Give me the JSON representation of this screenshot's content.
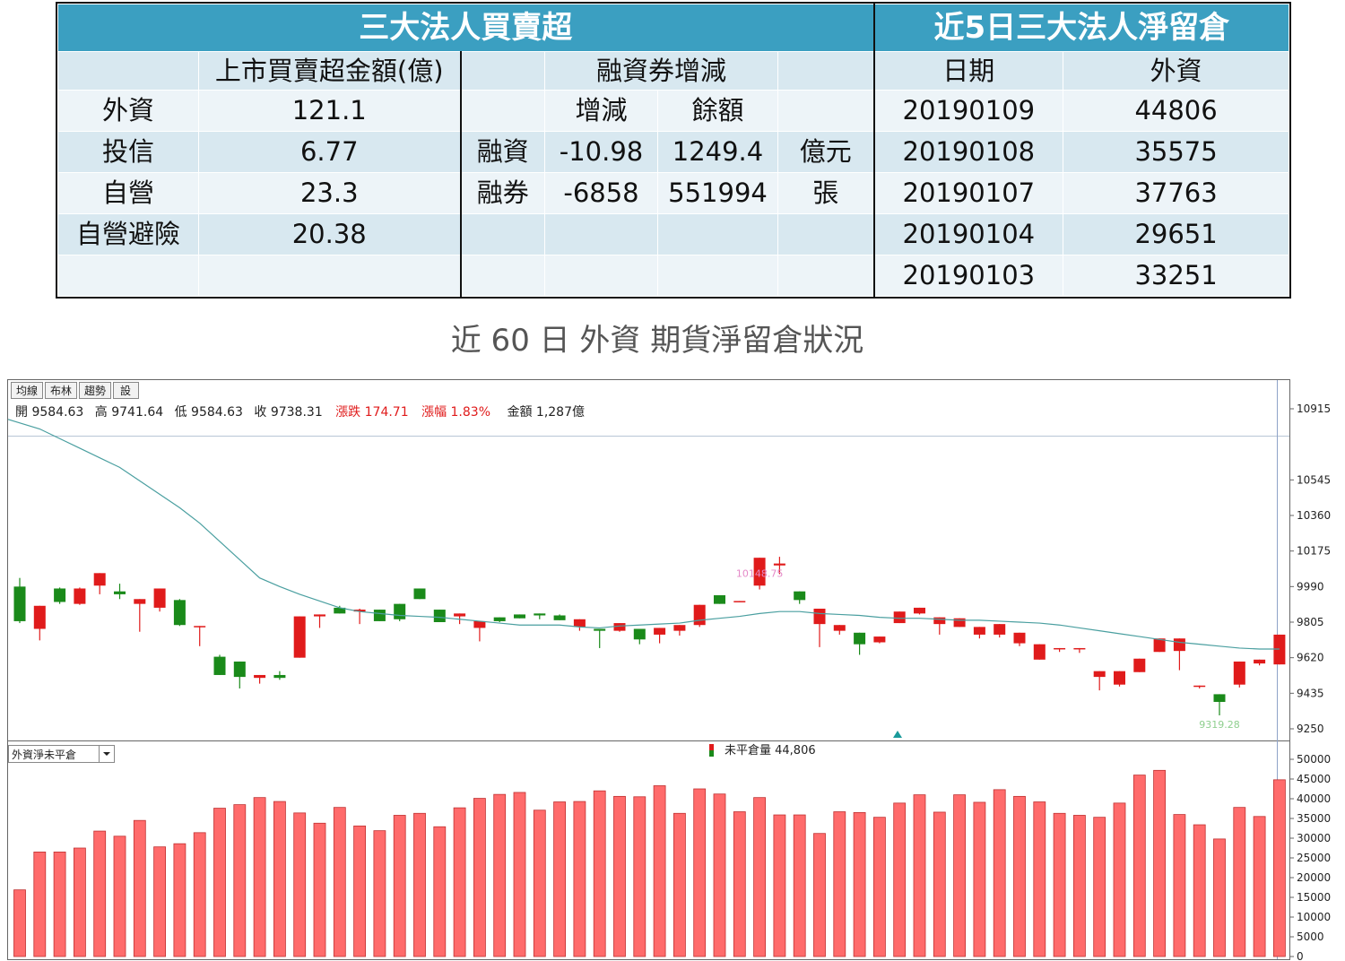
{
  "summary": {
    "left_title": "三大法人買賣超",
    "right_title": "近5日三大法人淨留倉",
    "col_amount": "上市買賣超金額(億)",
    "col_margin": "融資券增減",
    "col_date": "日期",
    "col_foreign": "外資",
    "sub_change": "增減",
    "sub_balance": "餘額",
    "investors": [
      {
        "name": "外資",
        "amount": "121.1"
      },
      {
        "name": "投信",
        "amount": "6.77"
      },
      {
        "name": "自營",
        "amount": "23.3"
      },
      {
        "name": "自營避險",
        "amount": "20.38"
      }
    ],
    "margin": [
      {
        "name": "融資",
        "change": "-10.98",
        "balance": "1249.4",
        "unit": "億元"
      },
      {
        "name": "融券",
        "change": "-6858",
        "balance": "551994",
        "unit": "張"
      }
    ],
    "positions": [
      {
        "date": "20190109",
        "foreign": "44806"
      },
      {
        "date": "20190108",
        "foreign": "35575"
      },
      {
        "date": "20190107",
        "foreign": "37763"
      },
      {
        "date": "20190104",
        "foreign": "29651"
      },
      {
        "date": "20190103",
        "foreign": "33251"
      }
    ]
  },
  "heading": "近 60 日 外資 期貨淨留倉狀況",
  "toolbar": {
    "buttons": [
      "均線",
      "布林",
      "趨勢",
      "設"
    ],
    "select_value": "外資淨未平倉"
  },
  "info_line": {
    "open": "開 9584.63",
    "high": "高 9741.64",
    "low": "低 9584.63",
    "close": "收 9738.31",
    "change": "漲跌 174.71",
    "pct": "漲幅 1.83%",
    "amount": "金額 1,287億"
  },
  "volume_legend": "未平倉量 44,806",
  "colors": {
    "up": "#e01b1b",
    "down": "#1a8a1a",
    "ma": "#4a9fa0",
    "bar": "#ff6b6b",
    "header": "#3b9fc1"
  },
  "chart_data": [
    {
      "type": "candlestick",
      "y_ticks": [
        10915,
        10545,
        10360,
        10175,
        9990,
        9805,
        9620,
        9435,
        9250
      ],
      "ylim": [
        9250,
        10915
      ],
      "annotations": [
        {
          "label": "10148.75",
          "index": 37
        },
        {
          "label": "9319.28",
          "index": 60
        }
      ],
      "candles": [
        [
          9990,
          10035,
          9800,
          9810
        ],
        [
          9770,
          9775,
          9710,
          9890
        ],
        [
          9980,
          9985,
          9900,
          9910
        ],
        [
          9900,
          9985,
          9895,
          9980
        ],
        [
          9995,
          10010,
          9950,
          10060
        ],
        [
          9965,
          10005,
          9925,
          9950
        ],
        [
          9900,
          9910,
          9755,
          9925
        ],
        [
          9880,
          9880,
          9860,
          9980
        ],
        [
          9920,
          9925,
          9785,
          9790
        ],
        [
          9780,
          9780,
          9680,
          9785
        ],
        [
          9625,
          9635,
          9560,
          9530
        ],
        [
          9600,
          9600,
          9460,
          9520
        ],
        [
          9515,
          9530,
          9485,
          9530
        ],
        [
          9530,
          9550,
          9505,
          9515
        ],
        [
          9620,
          9620,
          9620,
          9835
        ],
        [
          9835,
          9845,
          9775,
          9845
        ],
        [
          9880,
          9890,
          9880,
          9850
        ],
        [
          9860,
          9875,
          9795,
          9870
        ],
        [
          9870,
          9870,
          9810,
          9810
        ],
        [
          9900,
          9900,
          9810,
          9820
        ],
        [
          9980,
          9980,
          9950,
          9925
        ],
        [
          9870,
          9870,
          9825,
          9805
        ],
        [
          9835,
          9845,
          9795,
          9850
        ],
        [
          9775,
          9775,
          9705,
          9810
        ],
        [
          9830,
          9830,
          9805,
          9810
        ],
        [
          9845,
          9845,
          9825,
          9825
        ],
        [
          9850,
          9850,
          9820,
          9840
        ],
        [
          9840,
          9845,
          9815,
          9815
        ],
        [
          9780,
          9775,
          9760,
          9820
        ],
        [
          9770,
          9770,
          9670,
          9760
        ],
        [
          9760,
          9760,
          9755,
          9800
        ],
        [
          9770,
          9770,
          9690,
          9715
        ],
        [
          9740,
          9740,
          9695,
          9775
        ],
        [
          9760,
          9760,
          9735,
          9790
        ],
        [
          9790,
          9790,
          9780,
          9895
        ],
        [
          9945,
          9945,
          9900,
          9900
        ],
        [
          9915,
          9915,
          9910,
          9915
        ],
        [
          9995,
          9995,
          9975,
          10140
        ],
        [
          10100,
          10145,
          10055,
          10110
        ],
        [
          9965,
          9965,
          9900,
          9920
        ],
        [
          9795,
          9795,
          9675,
          9875
        ],
        [
          9760,
          9760,
          9740,
          9790
        ],
        [
          9750,
          9750,
          9635,
          9690
        ],
        [
          9700,
          9700,
          9695,
          9730
        ],
        [
          9800,
          9800,
          9800,
          9860
        ],
        [
          9850,
          9875,
          9845,
          9880
        ],
        [
          9795,
          9795,
          9740,
          9830
        ],
        [
          9780,
          9780,
          9790,
          9825
        ],
        [
          9740,
          9740,
          9720,
          9780
        ],
        [
          9740,
          9740,
          9725,
          9795
        ],
        [
          9695,
          9695,
          9680,
          9750
        ],
        [
          9610,
          9610,
          9675,
          9690
        ],
        [
          9665,
          9665,
          9650,
          9670
        ],
        [
          9665,
          9665,
          9645,
          9670
        ],
        [
          9520,
          9520,
          9450,
          9550
        ],
        [
          9480,
          9480,
          9470,
          9550
        ],
        [
          9545,
          9545,
          9570,
          9615
        ],
        [
          9650,
          9650,
          9655,
          9720
        ],
        [
          9655,
          9655,
          9555,
          9720
        ],
        [
          9475,
          9475,
          9460,
          9475
        ],
        [
          9430,
          9430,
          9320,
          9390
        ],
        [
          9480,
          9480,
          9465,
          9600
        ],
        [
          9590,
          9590,
          9580,
          9610
        ],
        [
          9585,
          9585,
          9585,
          9740
        ]
      ],
      "ma": [
        10860,
        10810,
        10760,
        10710,
        10660,
        10610,
        10540,
        10470,
        10400,
        10320,
        10225,
        10130,
        10035,
        9990,
        9950,
        9915,
        9880,
        9860,
        9850,
        9840,
        9835,
        9830,
        9820,
        9810,
        9800,
        9790,
        9790,
        9790,
        9780,
        9775,
        9785,
        9790,
        9795,
        9800,
        9815,
        9825,
        9835,
        9850,
        9860,
        9860,
        9850,
        9845,
        9840,
        9830,
        9825,
        9825,
        9820,
        9815,
        9815,
        9810,
        9805,
        9800,
        9790,
        9775,
        9760,
        9745,
        9730,
        9715,
        9700,
        9690,
        9680,
        9670,
        9665,
        9665
      ]
    },
    {
      "type": "bar",
      "name": "未平倉量",
      "y_ticks": [
        0,
        5000,
        10000,
        15000,
        20000,
        25000,
        30000,
        35000,
        40000,
        45000,
        50000
      ],
      "ylim": [
        0,
        50000
      ],
      "values": [
        16900,
        26500,
        26500,
        27500,
        31800,
        30500,
        34500,
        27800,
        28600,
        31400,
        37600,
        38500,
        40300,
        39300,
        36400,
        33800,
        37800,
        33100,
        31900,
        35800,
        36300,
        32900,
        37700,
        40100,
        41100,
        41600,
        37100,
        39200,
        39300,
        42000,
        40600,
        40500,
        43300,
        36300,
        42500,
        41200,
        36700,
        40300,
        35900,
        35900,
        31200,
        36700,
        36500,
        35300,
        38900,
        41000,
        36600,
        41000,
        39100,
        42300,
        40600,
        39200,
        36300,
        35800,
        35300,
        38900,
        46000,
        47200,
        36000,
        33400,
        29800,
        37800,
        35500,
        44806
      ]
    }
  ]
}
